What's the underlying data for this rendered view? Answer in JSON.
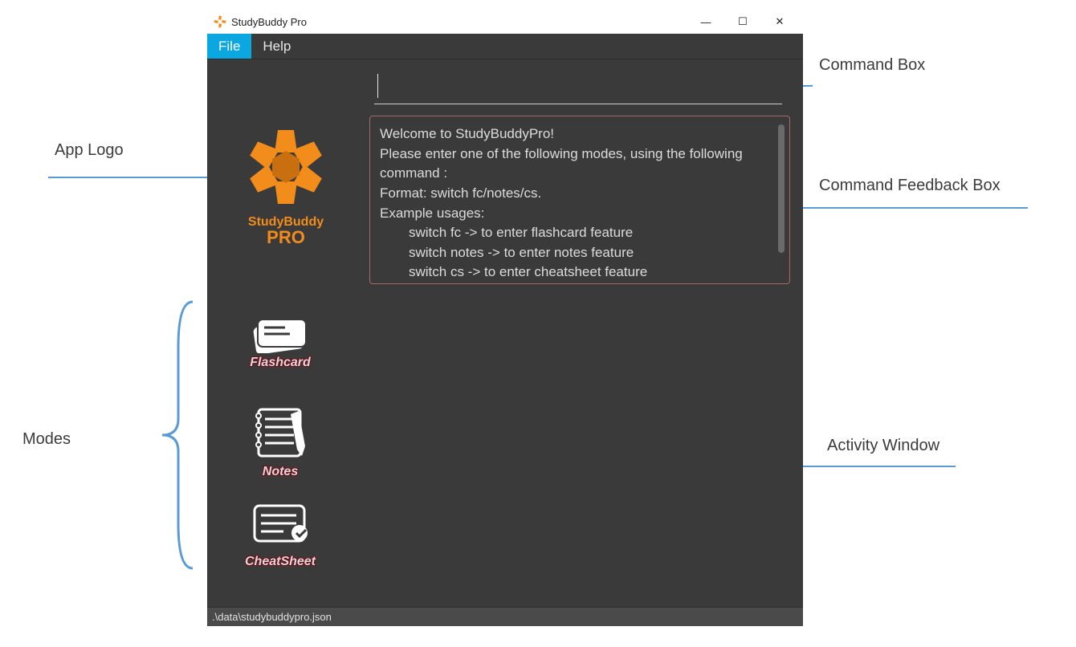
{
  "annotations": {
    "app_logo": "App Logo",
    "modes": "Modes",
    "command_box": "Command Box",
    "command_feedback_box": "Command Feedback Box",
    "activity_window": "Activity Window"
  },
  "titlebar": {
    "title": "StudyBuddy Pro"
  },
  "win_controls": {
    "minimize": "—",
    "maximize": "☐",
    "close": "✕"
  },
  "menubar": {
    "file": "File",
    "help": "Help"
  },
  "command_input": {
    "value": ""
  },
  "feedback": {
    "line1": "Welcome to StudyBuddyPro!",
    "line2": "Please enter one of the following modes, using the following command :",
    "line3": "Format: switch fc/notes/cs.",
    "line4": "Example usages:",
    "ex1": "switch fc -> to enter flashcard feature",
    "ex2": "switch notes -> to enter notes feature",
    "ex3": "switch cs -> to enter cheatsheet feature"
  },
  "logo": {
    "line1": "StudyBuddy",
    "line2": "PRO"
  },
  "modes": {
    "flashcard": "Flashcard",
    "notes": "Notes",
    "cheatsheet": "CheatSheet"
  },
  "statusbar": {
    "path": ".\\data\\studybuddypro.json"
  }
}
